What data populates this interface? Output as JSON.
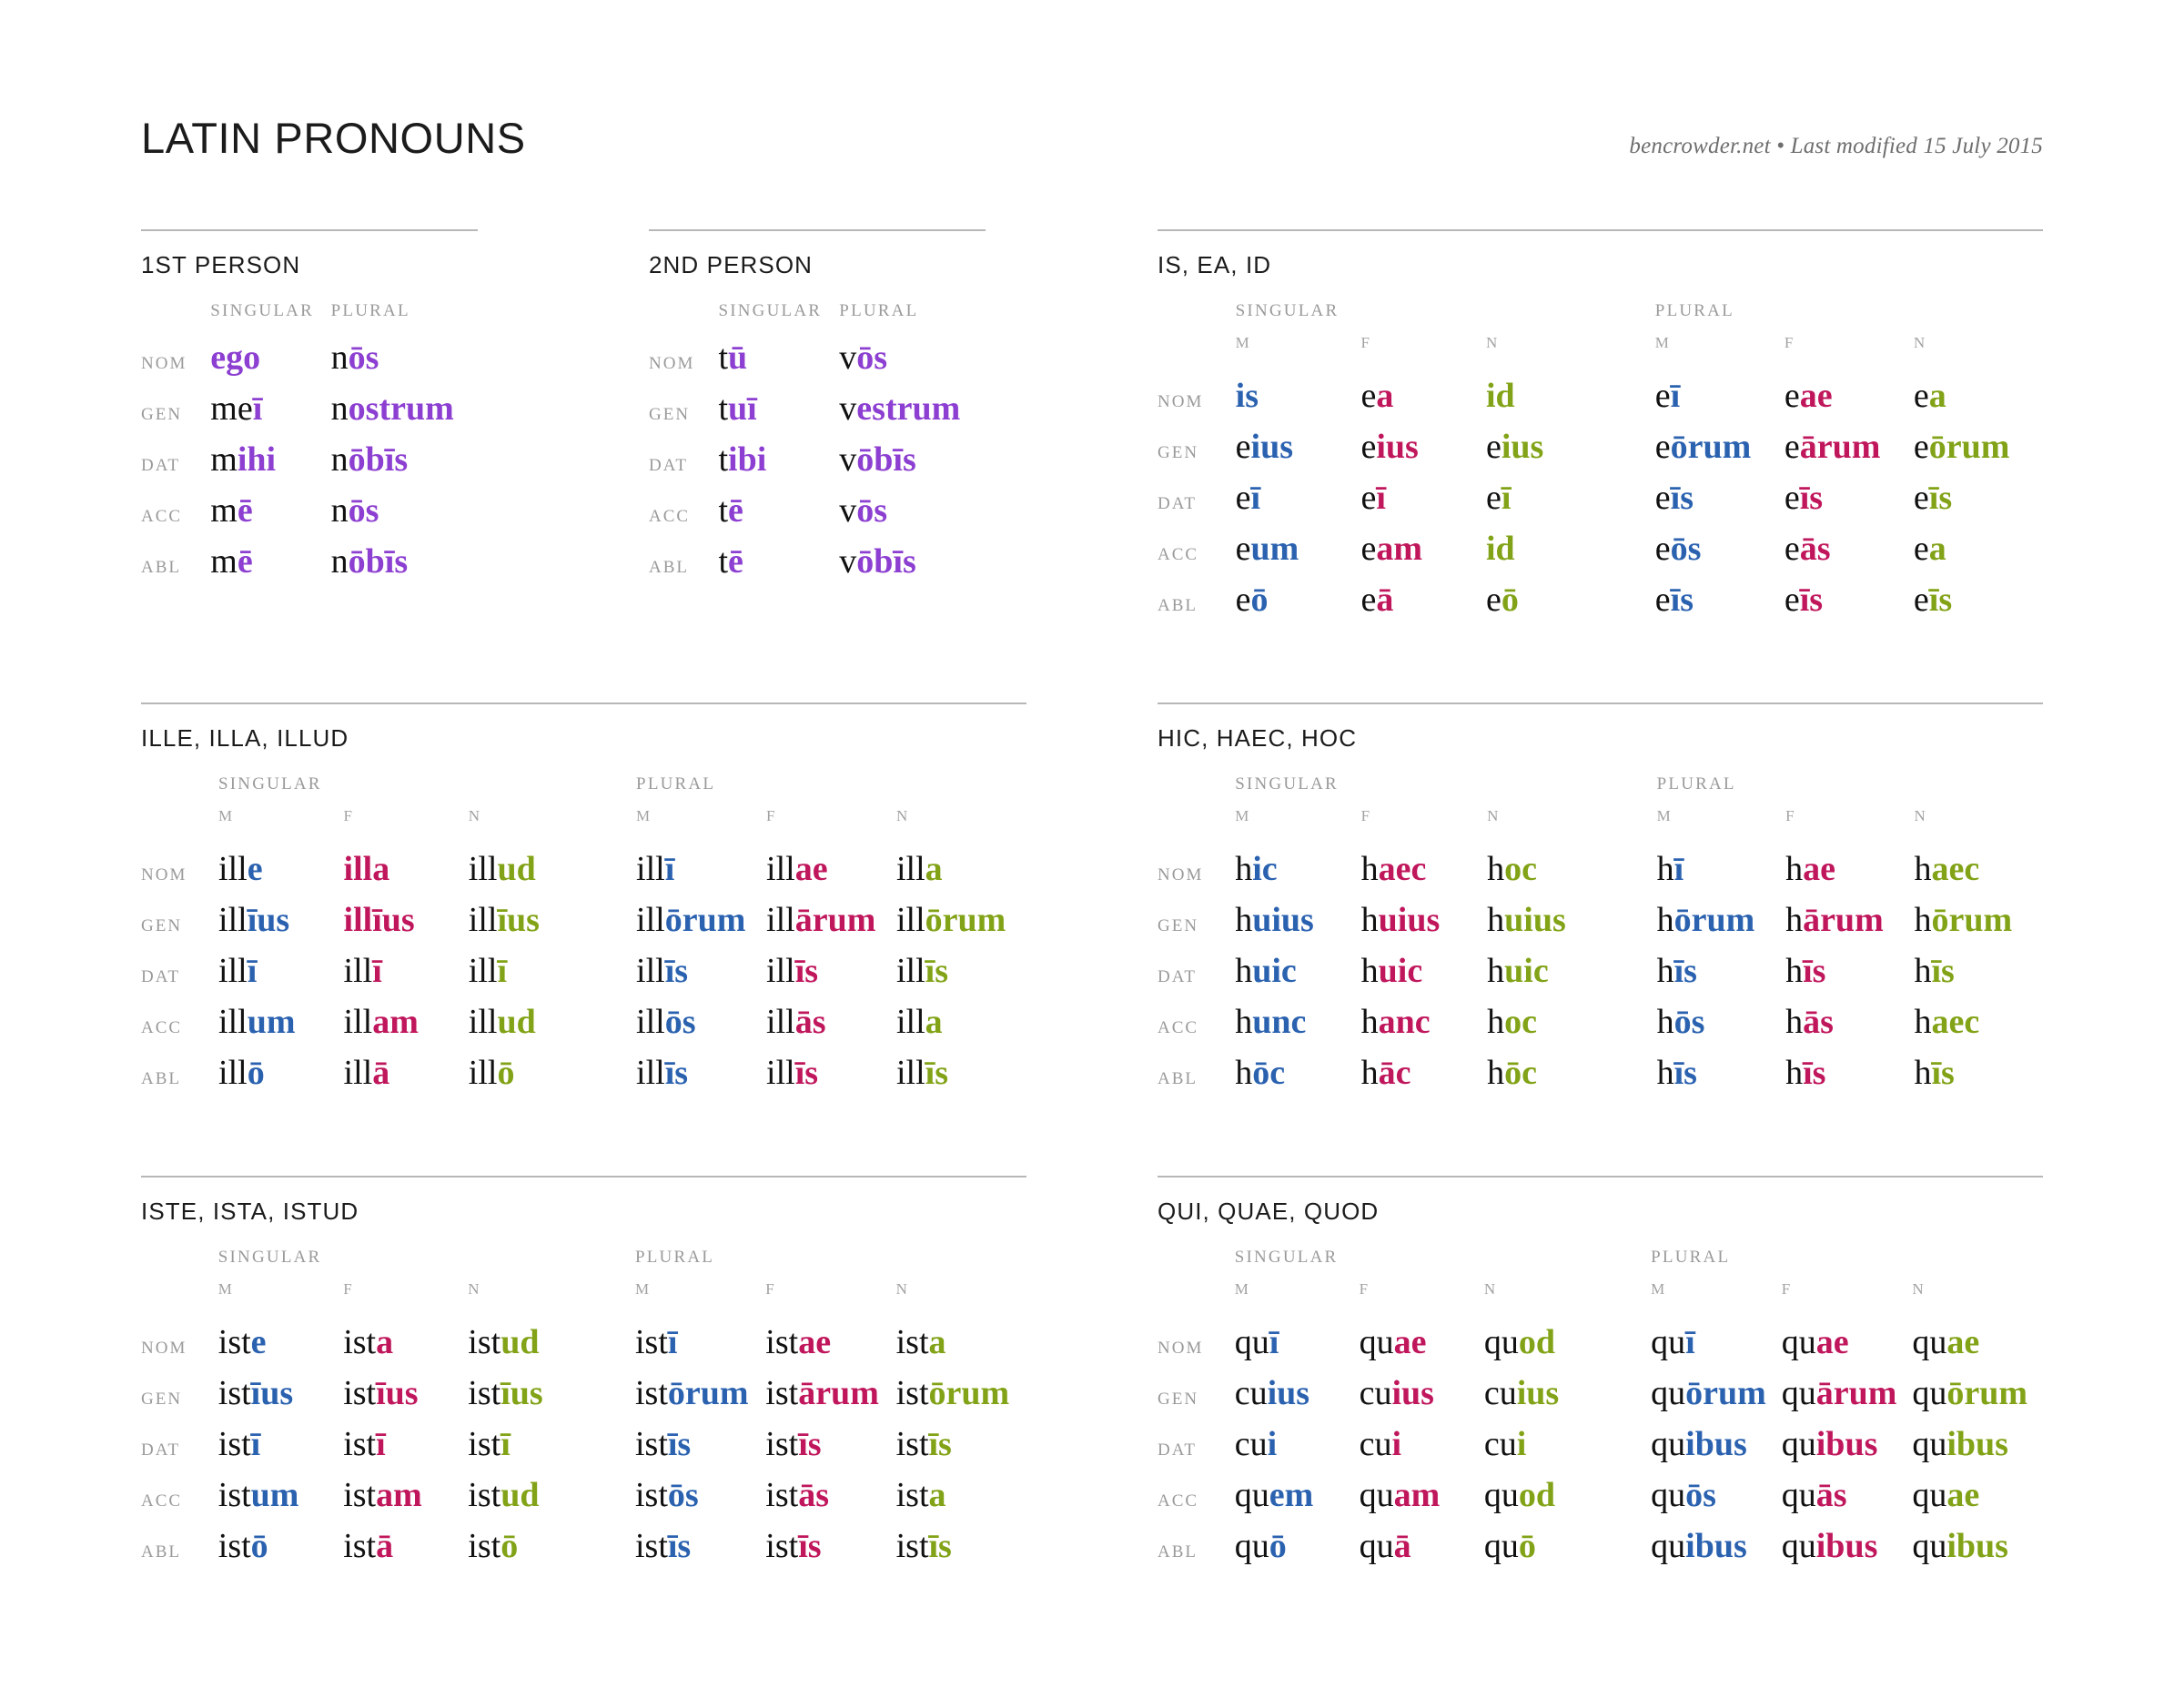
{
  "header": {
    "title": "LATIN PRONOUNS",
    "credit": "bencrowder.net • Last modified 15 July 2015"
  },
  "labels": {
    "singular": "SINGULAR",
    "plural": "PLURAL",
    "m": "M",
    "f": "F",
    "n": "N",
    "cases": [
      "NOM",
      "GEN",
      "DAT",
      "ACC",
      "ABL"
    ]
  },
  "colors": {
    "masculine": "#2b62b0",
    "feminine": "#c0175c",
    "neuter": "#82a317",
    "first_person": "#8c3fd1",
    "second_person": "#8c3fd1",
    "stem": "#111111",
    "label_gray": "#9a9a9a",
    "rule_gray": "#b7b7b7",
    "credit_gray": "#6e6e6e"
  },
  "sections": [
    {
      "id": "first-person",
      "title": "1ST PERSON",
      "type": "personal",
      "rows": [
        {
          "case": "NOM",
          "singular": [
            [
              "",
              "ego"
            ]
          ],
          "plural": [
            [
              "n",
              "ōs"
            ]
          ]
        },
        {
          "case": "GEN",
          "singular": [
            [
              "me",
              "ī"
            ]
          ],
          "plural": [
            [
              "n",
              "ostrum"
            ]
          ]
        },
        {
          "case": "DAT",
          "singular": [
            [
              "m",
              "ihi"
            ]
          ],
          "plural": [
            [
              "n",
              "ōbīs"
            ]
          ]
        },
        {
          "case": "ACC",
          "singular": [
            [
              "m",
              "ē"
            ]
          ],
          "plural": [
            [
              "n",
              "ōs"
            ]
          ]
        },
        {
          "case": "ABL",
          "singular": [
            [
              "m",
              "ē"
            ]
          ],
          "plural": [
            [
              "n",
              "ōbīs"
            ]
          ]
        }
      ]
    },
    {
      "id": "second-person",
      "title": "2ND PERSON",
      "type": "personal",
      "rows": [
        {
          "case": "NOM",
          "singular": [
            [
              "t",
              "ū"
            ]
          ],
          "plural": [
            [
              "v",
              "ōs"
            ]
          ]
        },
        {
          "case": "GEN",
          "singular": [
            [
              "t",
              "uī"
            ]
          ],
          "plural": [
            [
              "v",
              "estrum"
            ]
          ]
        },
        {
          "case": "DAT",
          "singular": [
            [
              "t",
              "ibi"
            ]
          ],
          "plural": [
            [
              "v",
              "ōbīs"
            ]
          ]
        },
        {
          "case": "ACC",
          "singular": [
            [
              "t",
              "ē"
            ]
          ],
          "plural": [
            [
              "v",
              "ōs"
            ]
          ]
        },
        {
          "case": "ABL",
          "singular": [
            [
              "t",
              "ē"
            ]
          ],
          "plural": [
            [
              "v",
              "ōbīs"
            ]
          ]
        }
      ]
    },
    {
      "id": "is-ea-id",
      "title": "IS, EA, ID",
      "type": "gendered",
      "rows": [
        {
          "case": "NOM",
          "sg": [
            [
              "",
              "is"
            ],
            [
              "e",
              "a"
            ],
            [
              "",
              "id"
            ]
          ],
          "pl": [
            [
              "e",
              "ī"
            ],
            [
              "e",
              "ae"
            ],
            [
              "e",
              "a"
            ]
          ]
        },
        {
          "case": "GEN",
          "sg": [
            [
              "e",
              "ius"
            ],
            [
              "e",
              "ius"
            ],
            [
              "e",
              "ius"
            ]
          ],
          "pl": [
            [
              "e",
              "ōrum"
            ],
            [
              "e",
              "ārum"
            ],
            [
              "e",
              "ōrum"
            ]
          ]
        },
        {
          "case": "DAT",
          "sg": [
            [
              "e",
              "ī"
            ],
            [
              "e",
              "ī"
            ],
            [
              "e",
              "ī"
            ]
          ],
          "pl": [
            [
              "e",
              "īs"
            ],
            [
              "e",
              "īs"
            ],
            [
              "e",
              "īs"
            ]
          ]
        },
        {
          "case": "ACC",
          "sg": [
            [
              "e",
              "um"
            ],
            [
              "e",
              "am"
            ],
            [
              "",
              "id"
            ]
          ],
          "pl": [
            [
              "e",
              "ōs"
            ],
            [
              "e",
              "ās"
            ],
            [
              "e",
              "a"
            ]
          ]
        },
        {
          "case": "ABL",
          "sg": [
            [
              "e",
              "ō"
            ],
            [
              "e",
              "ā"
            ],
            [
              "e",
              "ō"
            ]
          ],
          "pl": [
            [
              "e",
              "īs"
            ],
            [
              "e",
              "īs"
            ],
            [
              "e",
              "īs"
            ]
          ]
        }
      ]
    },
    {
      "id": "ille-illa-illud",
      "title": "ILLE, ILLA, ILLUD",
      "type": "gendered",
      "rows": [
        {
          "case": "NOM",
          "sg": [
            [
              "ill",
              "e"
            ],
            [
              "",
              "illa"
            ],
            [
              "ill",
              "ud"
            ]
          ],
          "pl": [
            [
              "ill",
              "ī"
            ],
            [
              "ill",
              "ae"
            ],
            [
              "ill",
              "a"
            ]
          ]
        },
        {
          "case": "GEN",
          "sg": [
            [
              "ill",
              "īus"
            ],
            [
              "",
              "illīus"
            ],
            [
              "ill",
              "īus"
            ]
          ],
          "pl": [
            [
              "ill",
              "ōrum"
            ],
            [
              "ill",
              "ārum"
            ],
            [
              "ill",
              "ōrum"
            ]
          ]
        },
        {
          "case": "DAT",
          "sg": [
            [
              "ill",
              "ī"
            ],
            [
              "ill",
              "ī"
            ],
            [
              "ill",
              "ī"
            ]
          ],
          "pl": [
            [
              "ill",
              "īs"
            ],
            [
              "ill",
              "īs"
            ],
            [
              "ill",
              "īs"
            ]
          ]
        },
        {
          "case": "ACC",
          "sg": [
            [
              "ill",
              "um"
            ],
            [
              "ill",
              "am"
            ],
            [
              "ill",
              "ud"
            ]
          ],
          "pl": [
            [
              "ill",
              "ōs"
            ],
            [
              "ill",
              "ās"
            ],
            [
              "ill",
              "a"
            ]
          ]
        },
        {
          "case": "ABL",
          "sg": [
            [
              "ill",
              "ō"
            ],
            [
              "ill",
              "ā"
            ],
            [
              "ill",
              "ō"
            ]
          ],
          "pl": [
            [
              "ill",
              "īs"
            ],
            [
              "ill",
              "īs"
            ],
            [
              "ill",
              "īs"
            ]
          ]
        }
      ]
    },
    {
      "id": "hic-haec-hoc",
      "title": "HIC, HAEC, HOC",
      "type": "gendered",
      "rows": [
        {
          "case": "NOM",
          "sg": [
            [
              "h",
              "ic"
            ],
            [
              "h",
              "aec"
            ],
            [
              "h",
              "oc"
            ]
          ],
          "pl": [
            [
              "h",
              "ī"
            ],
            [
              "h",
              "ae"
            ],
            [
              "h",
              "aec"
            ]
          ]
        },
        {
          "case": "GEN",
          "sg": [
            [
              "h",
              "uius"
            ],
            [
              "h",
              "uius"
            ],
            [
              "h",
              "uius"
            ]
          ],
          "pl": [
            [
              "h",
              "ōrum"
            ],
            [
              "h",
              "ārum"
            ],
            [
              "h",
              "ōrum"
            ]
          ]
        },
        {
          "case": "DAT",
          "sg": [
            [
              "h",
              "uic"
            ],
            [
              "h",
              "uic"
            ],
            [
              "h",
              "uic"
            ]
          ],
          "pl": [
            [
              "h",
              "īs"
            ],
            [
              "h",
              "īs"
            ],
            [
              "h",
              "īs"
            ]
          ]
        },
        {
          "case": "ACC",
          "sg": [
            [
              "h",
              "unc"
            ],
            [
              "h",
              "anc"
            ],
            [
              "h",
              "oc"
            ]
          ],
          "pl": [
            [
              "h",
              "ōs"
            ],
            [
              "h",
              "ās"
            ],
            [
              "h",
              "aec"
            ]
          ]
        },
        {
          "case": "ABL",
          "sg": [
            [
              "h",
              "ōc"
            ],
            [
              "h",
              "āc"
            ],
            [
              "h",
              "ōc"
            ]
          ],
          "pl": [
            [
              "h",
              "īs"
            ],
            [
              "h",
              "īs"
            ],
            [
              "h",
              "īs"
            ]
          ]
        }
      ]
    },
    {
      "id": "iste-ista-istud",
      "title": "ISTE, ISTA, ISTUD",
      "type": "gendered",
      "rows": [
        {
          "case": "NOM",
          "sg": [
            [
              "ist",
              "e"
            ],
            [
              "ist",
              "a"
            ],
            [
              "ist",
              "ud"
            ]
          ],
          "pl": [
            [
              "ist",
              "ī"
            ],
            [
              "ist",
              "ae"
            ],
            [
              "ist",
              "a"
            ]
          ]
        },
        {
          "case": "GEN",
          "sg": [
            [
              "ist",
              "īus"
            ],
            [
              "ist",
              "īus"
            ],
            [
              "ist",
              "īus"
            ]
          ],
          "pl": [
            [
              "ist",
              "ōrum"
            ],
            [
              "ist",
              "ārum"
            ],
            [
              "ist",
              "ōrum"
            ]
          ]
        },
        {
          "case": "DAT",
          "sg": [
            [
              "ist",
              "ī"
            ],
            [
              "ist",
              "ī"
            ],
            [
              "ist",
              "ī"
            ]
          ],
          "pl": [
            [
              "ist",
              "īs"
            ],
            [
              "ist",
              "īs"
            ],
            [
              "ist",
              "īs"
            ]
          ]
        },
        {
          "case": "ACC",
          "sg": [
            [
              "ist",
              "um"
            ],
            [
              "ist",
              "am"
            ],
            [
              "ist",
              "ud"
            ]
          ],
          "pl": [
            [
              "ist",
              "ōs"
            ],
            [
              "ist",
              "ās"
            ],
            [
              "ist",
              "a"
            ]
          ]
        },
        {
          "case": "ABL",
          "sg": [
            [
              "ist",
              "ō"
            ],
            [
              "ist",
              "ā"
            ],
            [
              "ist",
              "ō"
            ]
          ],
          "pl": [
            [
              "ist",
              "īs"
            ],
            [
              "ist",
              "īs"
            ],
            [
              "ist",
              "īs"
            ]
          ]
        }
      ]
    },
    {
      "id": "qui-quae-quod",
      "title": "QUI, QUAE, QUOD",
      "type": "gendered",
      "rows": [
        {
          "case": "NOM",
          "sg": [
            [
              "qu",
              "ī"
            ],
            [
              "qu",
              "ae"
            ],
            [
              "qu",
              "od"
            ]
          ],
          "pl": [
            [
              "qu",
              "ī"
            ],
            [
              "qu",
              "ae"
            ],
            [
              "qu",
              "ae"
            ]
          ]
        },
        {
          "case": "GEN",
          "sg": [
            [
              "cu",
              "ius"
            ],
            [
              "cu",
              "ius"
            ],
            [
              "cu",
              "ius"
            ]
          ],
          "pl": [
            [
              "qu",
              "ōrum"
            ],
            [
              "qu",
              "ārum"
            ],
            [
              "qu",
              "ōrum"
            ]
          ]
        },
        {
          "case": "DAT",
          "sg": [
            [
              "cu",
              "i"
            ],
            [
              "cu",
              "i"
            ],
            [
              "cu",
              "i"
            ]
          ],
          "pl": [
            [
              "qu",
              "ibus"
            ],
            [
              "qu",
              "ibus"
            ],
            [
              "qu",
              "ibus"
            ]
          ]
        },
        {
          "case": "ACC",
          "sg": [
            [
              "qu",
              "em"
            ],
            [
              "qu",
              "am"
            ],
            [
              "qu",
              "od"
            ]
          ],
          "pl": [
            [
              "qu",
              "ōs"
            ],
            [
              "qu",
              "ās"
            ],
            [
              "qu",
              "ae"
            ]
          ]
        },
        {
          "case": "ABL",
          "sg": [
            [
              "qu",
              "ō"
            ],
            [
              "qu",
              "ā"
            ],
            [
              "qu",
              "ō"
            ]
          ],
          "pl": [
            [
              "qu",
              "ibus"
            ],
            [
              "qu",
              "ibus"
            ],
            [
              "qu",
              "ibus"
            ]
          ]
        }
      ]
    }
  ]
}
